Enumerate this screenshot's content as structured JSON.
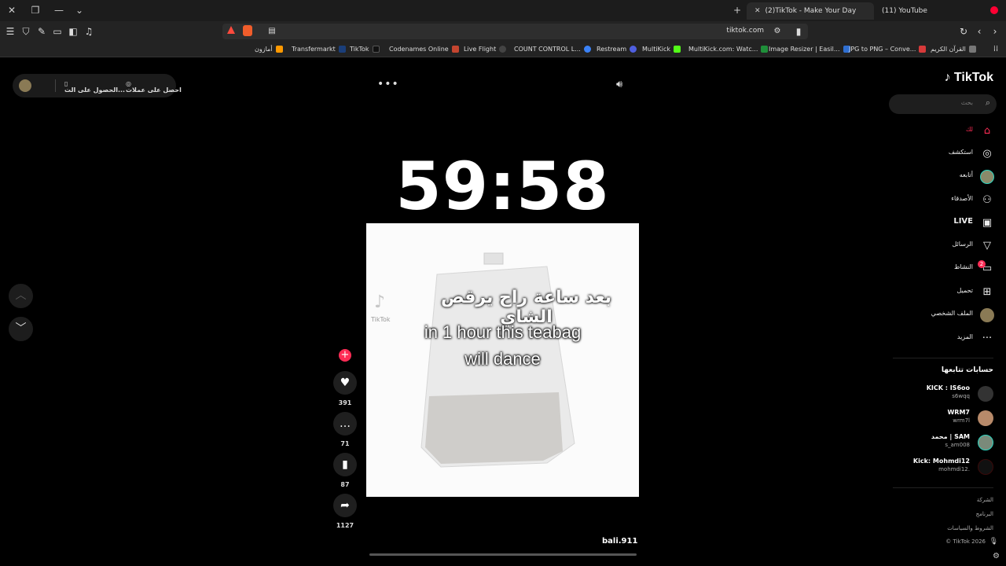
{
  "browser": {
    "tabs": [
      {
        "label": "(2)TikTok - Make Your Day",
        "active": true
      },
      {
        "label": "(11) YouTube",
        "active": false
      }
    ],
    "url": "tiktok.com",
    "bookmarks": [
      {
        "label": "أمازون",
        "color": "#ff9900"
      },
      {
        "label": "Transfermarkt",
        "color": "#1a3e7a"
      },
      {
        "label": "TikTok",
        "color": "#111111"
      },
      {
        "label": "Codenames Online",
        "color": "#c4452f"
      },
      {
        "label": "Live Flight",
        "color": "#444444"
      },
      {
        "label": "COUNT CONTROL L...",
        "color": "#3b82f6"
      },
      {
        "label": "Restream",
        "color": "#4f5fe0"
      },
      {
        "label": "MultiKick",
        "color": "#53fc18"
      },
      {
        "label": "MultiKick.com: Watc...",
        "color": "#1f8f3a"
      },
      {
        "label": "Image Resizer | Easil...",
        "color": "#2f6fd1"
      },
      {
        "label": "JPG to PNG – Conve...",
        "color": "#d73a3a"
      },
      {
        "label": "القرآن الكريم",
        "color": "#777777"
      }
    ]
  },
  "promo": {
    "coins_label": "احصل على عملات",
    "app_label": "الحصول على الت..."
  },
  "video": {
    "timer": "59:58",
    "caption_ar": "بعد ساعة راح يرقص الشاي",
    "caption_en_1": "in 1 hour this teabag",
    "caption_en_2": "will dance",
    "author": "bali.911",
    "watermark": "TikTok"
  },
  "actions": {
    "likes": "391",
    "comments": "71",
    "saves": "87",
    "shares": "1127"
  },
  "sidebar": {
    "logo": "TikTok",
    "search_placeholder": "بحث",
    "nav": [
      {
        "label": "لك",
        "icon": "home-icon",
        "active": true
      },
      {
        "label": "استكشف",
        "icon": "compass-icon"
      },
      {
        "label": "أتابعه",
        "icon": "avatar-icon"
      },
      {
        "label": "الأصدقاء",
        "icon": "friends-icon"
      },
      {
        "label": "LIVE",
        "icon": "live-icon"
      },
      {
        "label": "الرسائل",
        "icon": "send-icon"
      },
      {
        "label": "النشاط",
        "icon": "inbox-icon",
        "badge": "2"
      },
      {
        "label": "تحميل",
        "icon": "upload-icon"
      },
      {
        "label": "الملف الشخصي",
        "icon": "profile-icon"
      },
      {
        "label": "المزيد",
        "icon": "more-icon"
      }
    ],
    "following_title": "حسابات تتابعها",
    "following": [
      {
        "name": "KICK : IS6oo",
        "handle": "s6wqq"
      },
      {
        "name": "WRM7",
        "handle": "wrm7l"
      },
      {
        "name": "محمد | SAM",
        "handle": "s_am008"
      },
      {
        "name": "Kick: Mohmdi12",
        "handle": "mohmdi12."
      }
    ],
    "footer": [
      "الشركة",
      "البرنامج",
      "الشروط والسياسات",
      "© TikTok 2026"
    ]
  },
  "colors": {
    "accent": "#fe2c55",
    "background": "#000000"
  }
}
